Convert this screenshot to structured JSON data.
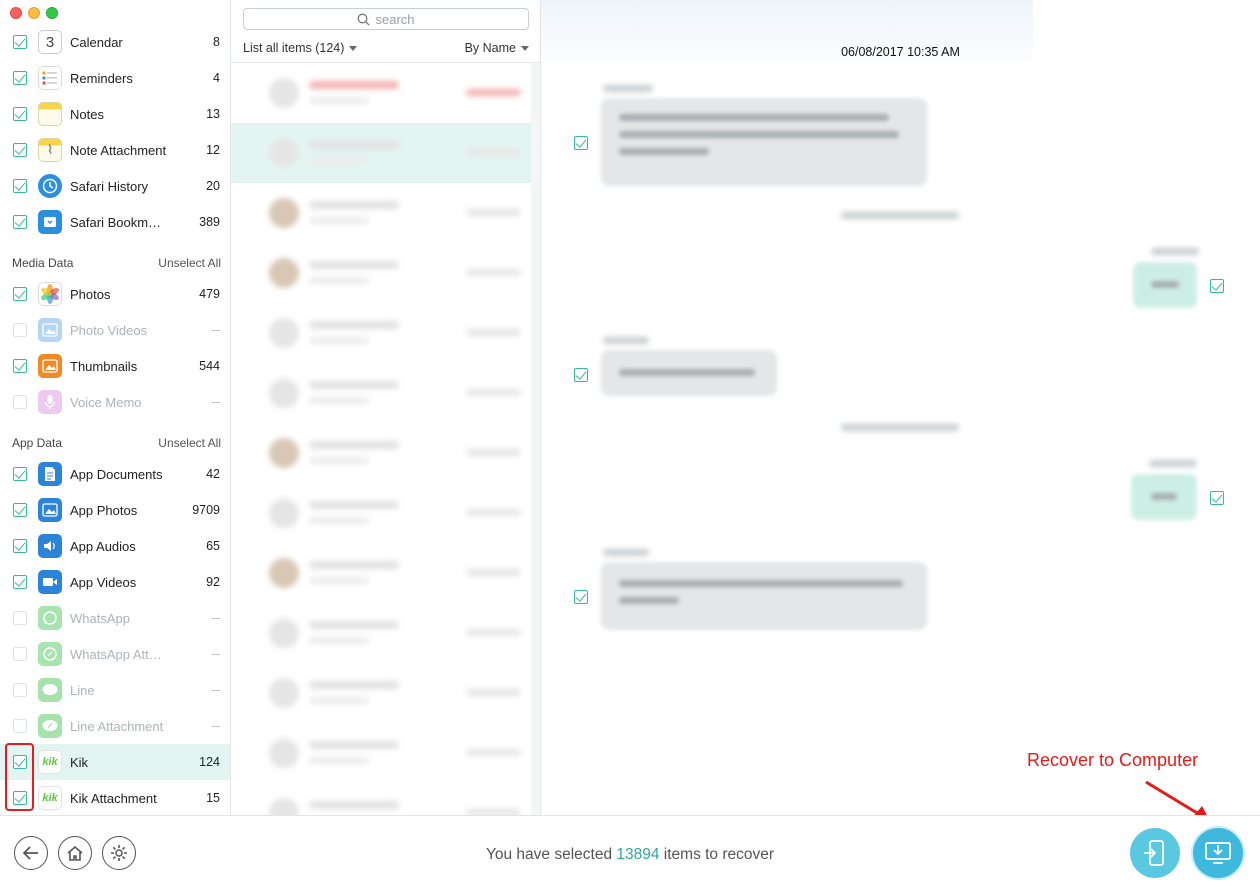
{
  "window": {
    "controls": [
      "close",
      "minimize",
      "maximize"
    ]
  },
  "sidebar": {
    "top_items": [
      {
        "label": "Calendar",
        "count": "8",
        "checked": true,
        "icon": "calendar-icon"
      },
      {
        "label": "Reminders",
        "count": "4",
        "checked": true,
        "icon": "reminders-icon"
      },
      {
        "label": "Notes",
        "count": "13",
        "checked": true,
        "icon": "notes-icon"
      },
      {
        "label": "Note Attachment",
        "count": "12",
        "checked": true,
        "icon": "note-attachment-icon"
      },
      {
        "label": "Safari History",
        "count": "20",
        "checked": true,
        "icon": "safari-history-icon"
      },
      {
        "label": "Safari Bookm…",
        "count": "389",
        "checked": true,
        "icon": "safari-bookmarks-icon"
      }
    ],
    "media_section": {
      "title": "Media Data",
      "unselect": "Unselect All"
    },
    "media_items": [
      {
        "label": "Photos",
        "count": "479",
        "checked": true,
        "icon": "photos-icon"
      },
      {
        "label": "Photo Videos",
        "count": "--",
        "checked": false,
        "icon": "photo-videos-icon"
      },
      {
        "label": "Thumbnails",
        "count": "544",
        "checked": true,
        "icon": "thumbnails-icon"
      },
      {
        "label": "Voice Memo",
        "count": "--",
        "checked": false,
        "icon": "voice-memo-icon"
      }
    ],
    "app_section": {
      "title": "App Data",
      "unselect": "Unselect All"
    },
    "app_items": [
      {
        "label": "App Documents",
        "count": "42",
        "checked": true,
        "icon": "app-documents-icon"
      },
      {
        "label": "App Photos",
        "count": "9709",
        "checked": true,
        "icon": "app-photos-icon"
      },
      {
        "label": "App Audios",
        "count": "65",
        "checked": true,
        "icon": "app-audios-icon"
      },
      {
        "label": "App Videos",
        "count": "92",
        "checked": true,
        "icon": "app-videos-icon"
      },
      {
        "label": "WhatsApp",
        "count": "--",
        "checked": false,
        "icon": "whatsapp-icon"
      },
      {
        "label": "WhatsApp Att…",
        "count": "--",
        "checked": false,
        "icon": "whatsapp-attachment-icon"
      },
      {
        "label": "Line",
        "count": "--",
        "checked": false,
        "icon": "line-icon"
      },
      {
        "label": "Line Attachment",
        "count": "--",
        "checked": false,
        "icon": "line-attachment-icon"
      },
      {
        "label": "Kik",
        "count": "124",
        "checked": true,
        "icon": "kik-icon",
        "selected": true
      },
      {
        "label": "Kik Attachment",
        "count": "15",
        "checked": true,
        "icon": "kik-attachment-icon"
      }
    ],
    "calendar_day": "3",
    "kik_glyph": "kik"
  },
  "list": {
    "search_placeholder": "search",
    "filter_label": "List all items (124)",
    "sort_label": "By Name"
  },
  "chat": {
    "date_header": "06/08/2017 10:35 AM"
  },
  "annotation": {
    "text": "Recover to Computer",
    "color": "#e81919"
  },
  "bottom": {
    "status_prefix": "You have selected ",
    "status_count": "13894",
    "status_suffix": " items to recover"
  },
  "colors": {
    "accent": "#39b7a2",
    "selected_row": "#e3f5f2",
    "recover_button": "#3eb9dd"
  }
}
